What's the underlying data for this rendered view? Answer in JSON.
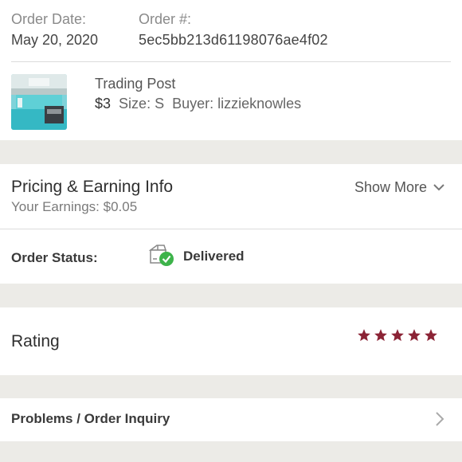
{
  "order": {
    "date_label": "Order Date:",
    "date_value": "May 20, 2020",
    "number_label": "Order #:",
    "number_value": "5ec5bb213d61198076ae4f02"
  },
  "item": {
    "title": "Trading Post",
    "price": "$3",
    "size_text": "Size: S",
    "buyer_text": "Buyer: lizzieknowles",
    "thumbnail_icon": "product-photo"
  },
  "pricing": {
    "title": "Pricing & Earning Info",
    "earnings": "Your Earnings: $0.05",
    "show_more_label": "Show More",
    "show_more_icon": "chevron-down-icon"
  },
  "status": {
    "label": "Order Status:",
    "value": "Delivered",
    "icon": "delivered-box-icon",
    "icon_color": "#3db34a"
  },
  "rating": {
    "label": "Rating",
    "stars": 5,
    "max_stars": 5,
    "star_color": "#8b2335"
  },
  "problems": {
    "label": "Problems / Order Inquiry",
    "icon": "chevron-right-icon"
  }
}
